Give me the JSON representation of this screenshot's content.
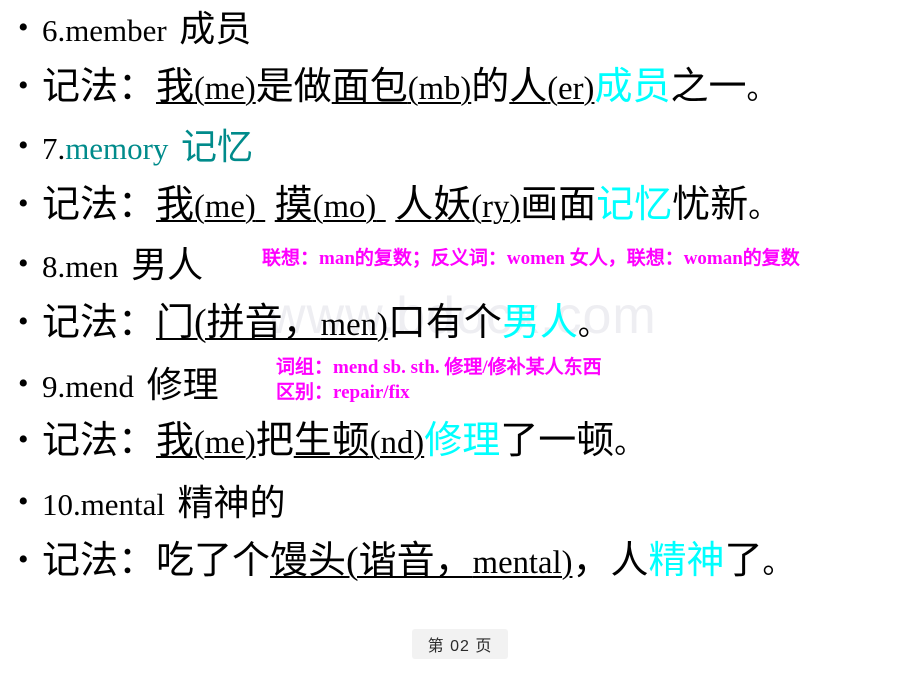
{
  "slide": {
    "page_footer": "第 02 页",
    "watermark": "www.bdocx.com",
    "colors": {
      "text": "#000000",
      "highlight_cyan": "#00ffff",
      "teal": "#008b8b",
      "annotation_magenta": "#ff00ff",
      "watermark_gray": "#eeeef2",
      "background": "#ffffff"
    }
  },
  "bullets": [
    {
      "id": "entry-6-headword",
      "bullet": "•",
      "segments": [
        {
          "text": "6.",
          "style": "plain-latin"
        },
        {
          "text": "member",
          "style": "plain-latin"
        },
        {
          "text": " ",
          "style": "space"
        },
        {
          "text": "成员",
          "style": "plain"
        }
      ],
      "plain": "6.member 成员"
    },
    {
      "id": "entry-6-mnemonic",
      "bullet": "•",
      "segments": [
        {
          "text": "记法：",
          "style": "plain"
        },
        {
          "text": "我",
          "style": "underline"
        },
        {
          "text": "(me)",
          "style": "underline-latin"
        },
        {
          "text": "是做",
          "style": "plain"
        },
        {
          "text": "面包",
          "style": "underline"
        },
        {
          "text": "(mb)",
          "style": "underline-latin"
        },
        {
          "text": "的",
          "style": "plain"
        },
        {
          "text": "人",
          "style": "underline"
        },
        {
          "text": "(er)",
          "style": "underline-latin"
        },
        {
          "text": "成员",
          "style": "cyan"
        },
        {
          "text": "之一。",
          "style": "plain"
        }
      ],
      "plain": "记法：我(me)是做面包(mb)的人(er)成员之一。"
    },
    {
      "id": "entry-7-headword",
      "bullet": "•",
      "segments": [
        {
          "text": "7.",
          "style": "plain-latin"
        },
        {
          "text": "memory",
          "style": "teal-latin"
        },
        {
          "text": " ",
          "style": "space"
        },
        {
          "text": "记忆",
          "style": "teal"
        }
      ],
      "plain": "7.memory 记忆"
    },
    {
      "id": "entry-7-mnemonic",
      "bullet": "•",
      "segments": [
        {
          "text": "记法：",
          "style": "plain"
        },
        {
          "text": "我",
          "style": "underline"
        },
        {
          "text": "(me)",
          "style": "underline-latin"
        },
        {
          "text": "  ",
          "style": "space"
        },
        {
          "text": "摸",
          "style": "underline"
        },
        {
          "text": "(mo)",
          "style": "underline-latin"
        },
        {
          "text": "  ",
          "style": "space"
        },
        {
          "text": "人妖",
          "style": "underline"
        },
        {
          "text": "(ry)",
          "style": "underline-latin"
        },
        {
          "text": "画面",
          "style": "plain"
        },
        {
          "text": "记忆",
          "style": "cyan"
        },
        {
          "text": "忧新。",
          "style": "plain"
        }
      ],
      "plain": "记法：我(me) 摸(mo) 人妖(ry)画面记忆忧新。"
    },
    {
      "id": "entry-8-headword",
      "bullet": "•",
      "segments": [
        {
          "text": "8.",
          "style": "plain-latin"
        },
        {
          "text": "men",
          "style": "plain-latin"
        },
        {
          "text": " ",
          "style": "space"
        },
        {
          "text": "男人",
          "style": "plain"
        }
      ],
      "plain": "8.men 男人"
    },
    {
      "id": "entry-8-mnemonic",
      "bullet": "•",
      "segments": [
        {
          "text": "记法：",
          "style": "plain"
        },
        {
          "text": "门(拼音，",
          "style": "underline"
        },
        {
          "text": "men)",
          "style": "underline-latin"
        },
        {
          "text": "口有个",
          "style": "plain"
        },
        {
          "text": "男人",
          "style": "cyan"
        },
        {
          "text": "。",
          "style": "plain"
        }
      ],
      "plain": "记法：门(拼音，men)口有个男人。"
    },
    {
      "id": "entry-9-headword",
      "bullet": "•",
      "segments": [
        {
          "text": "9.",
          "style": "plain-latin"
        },
        {
          "text": "mend",
          "style": "plain-latin"
        },
        {
          "text": " ",
          "style": "space"
        },
        {
          "text": "修理",
          "style": "plain"
        }
      ],
      "plain": "9.mend 修理"
    },
    {
      "id": "entry-9-mnemonic",
      "bullet": "•",
      "segments": [
        {
          "text": "记法：",
          "style": "plain"
        },
        {
          "text": "我",
          "style": "underline"
        },
        {
          "text": "(me)",
          "style": "underline-latin"
        },
        {
          "text": "把",
          "style": "plain"
        },
        {
          "text": "生顿",
          "style": "underline"
        },
        {
          "text": "(nd)",
          "style": "underline-latin"
        },
        {
          "text": "修理",
          "style": "cyan"
        },
        {
          "text": "了一顿。",
          "style": "plain"
        }
      ],
      "plain": "记法：我(me)把生顿(nd)修理了一顿。"
    },
    {
      "id": "entry-10-headword",
      "bullet": "•",
      "segments": [
        {
          "text": "10.",
          "style": "plain-latin"
        },
        {
          "text": "mental",
          "style": "plain-latin"
        },
        {
          "text": " ",
          "style": "space"
        },
        {
          "text": "精神的",
          "style": "plain"
        }
      ],
      "plain": "10.mental 精神的"
    },
    {
      "id": "entry-10-mnemonic",
      "bullet": "•",
      "segments": [
        {
          "text": "记法：吃了个",
          "style": "plain"
        },
        {
          "text": "馒头(谐音，",
          "style": "underline"
        },
        {
          "text": "mental)",
          "style": "underline-latin"
        },
        {
          "text": "，人",
          "style": "plain"
        },
        {
          "text": "精神",
          "style": "cyan"
        },
        {
          "text": "了。",
          "style": "plain"
        }
      ],
      "plain": "记法：吃了个馒头(谐音，mental)，人精神了。"
    }
  ],
  "annotations": {
    "men_note": {
      "label": "联想：man的复数；反义词：women 女人，联想：woman的复数",
      "color": "#ff00ff"
    },
    "mend_note": {
      "line1": "词组：mend  sb. sth. 修理/修补某人东西",
      "line2": "区别：repair/fix",
      "color": "#ff00ff"
    }
  }
}
